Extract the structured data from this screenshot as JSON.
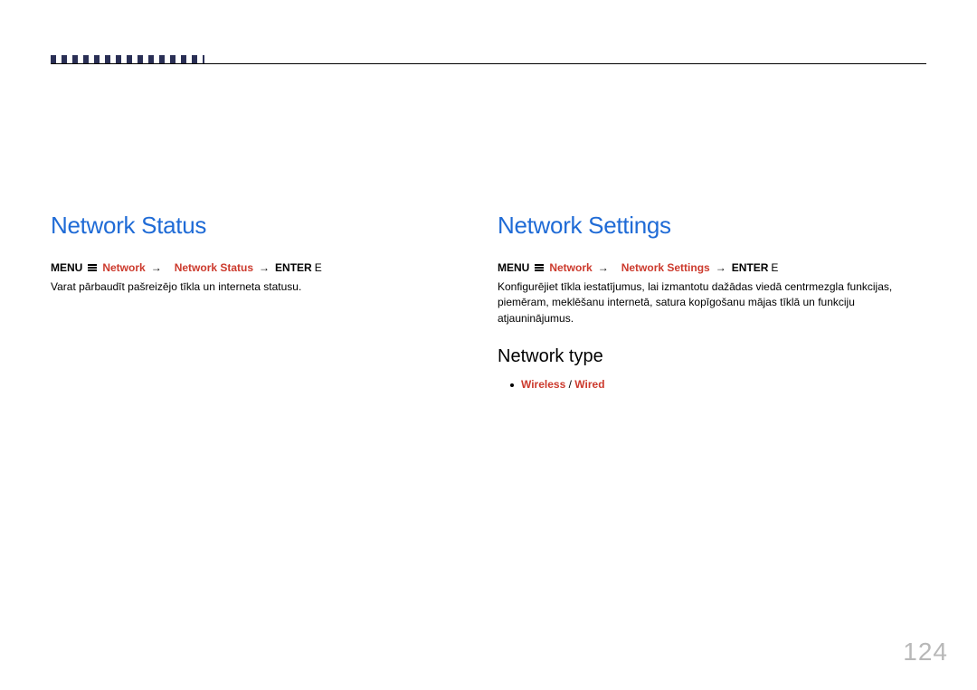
{
  "pageNumber": "124",
  "left": {
    "heading": "Network Status",
    "breadcrumb": {
      "menu": "MENU",
      "nav1": "Network",
      "arrow": "→",
      "nav2": "Network Status",
      "enter": "ENTER",
      "enterKey": "E"
    },
    "desc": "Varat pārbaudīt pašreizējo tīkla un interneta statusu."
  },
  "right": {
    "heading": "Network Settings",
    "breadcrumb": {
      "menu": "MENU",
      "nav1": "Network",
      "arrow": "→",
      "nav2": "Network Settings",
      "enter": "ENTER",
      "enterKey": "E"
    },
    "desc": "Konfigurējiet tīkla iestatījumus, lai izmantotu dažādas viedā centrmezgla funkcijas, piemēram, meklēšanu internetā, satura kopīgošanu mājas tīklā un funkciju atjauninājumus.",
    "subheading": "Network type",
    "options": {
      "wireless": "Wireless",
      "sep": "/",
      "wired": "Wired"
    }
  }
}
